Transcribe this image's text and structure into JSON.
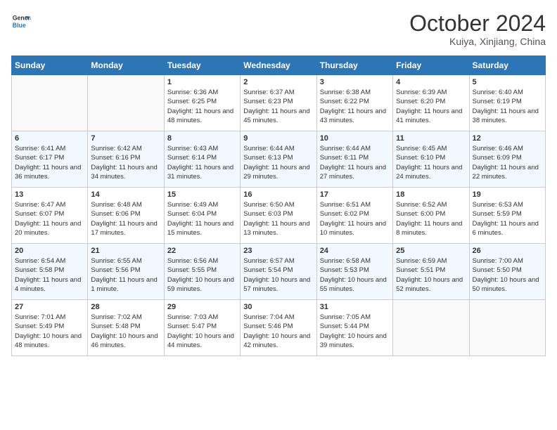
{
  "header": {
    "logo_line1": "General",
    "logo_line2": "Blue",
    "main_title": "October 2024",
    "subtitle": "Kuiya, Xinjiang, China"
  },
  "weekdays": [
    "Sunday",
    "Monday",
    "Tuesday",
    "Wednesday",
    "Thursday",
    "Friday",
    "Saturday"
  ],
  "weeks": [
    [
      {
        "day": "",
        "sunrise": "",
        "sunset": "",
        "daylight": ""
      },
      {
        "day": "",
        "sunrise": "",
        "sunset": "",
        "daylight": ""
      },
      {
        "day": "1",
        "sunrise": "Sunrise: 6:36 AM",
        "sunset": "Sunset: 6:25 PM",
        "daylight": "Daylight: 11 hours and 48 minutes."
      },
      {
        "day": "2",
        "sunrise": "Sunrise: 6:37 AM",
        "sunset": "Sunset: 6:23 PM",
        "daylight": "Daylight: 11 hours and 45 minutes."
      },
      {
        "day": "3",
        "sunrise": "Sunrise: 6:38 AM",
        "sunset": "Sunset: 6:22 PM",
        "daylight": "Daylight: 11 hours and 43 minutes."
      },
      {
        "day": "4",
        "sunrise": "Sunrise: 6:39 AM",
        "sunset": "Sunset: 6:20 PM",
        "daylight": "Daylight: 11 hours and 41 minutes."
      },
      {
        "day": "5",
        "sunrise": "Sunrise: 6:40 AM",
        "sunset": "Sunset: 6:19 PM",
        "daylight": "Daylight: 11 hours and 38 minutes."
      }
    ],
    [
      {
        "day": "6",
        "sunrise": "Sunrise: 6:41 AM",
        "sunset": "Sunset: 6:17 PM",
        "daylight": "Daylight: 11 hours and 36 minutes."
      },
      {
        "day": "7",
        "sunrise": "Sunrise: 6:42 AM",
        "sunset": "Sunset: 6:16 PM",
        "daylight": "Daylight: 11 hours and 34 minutes."
      },
      {
        "day": "8",
        "sunrise": "Sunrise: 6:43 AM",
        "sunset": "Sunset: 6:14 PM",
        "daylight": "Daylight: 11 hours and 31 minutes."
      },
      {
        "day": "9",
        "sunrise": "Sunrise: 6:44 AM",
        "sunset": "Sunset: 6:13 PM",
        "daylight": "Daylight: 11 hours and 29 minutes."
      },
      {
        "day": "10",
        "sunrise": "Sunrise: 6:44 AM",
        "sunset": "Sunset: 6:11 PM",
        "daylight": "Daylight: 11 hours and 27 minutes."
      },
      {
        "day": "11",
        "sunrise": "Sunrise: 6:45 AM",
        "sunset": "Sunset: 6:10 PM",
        "daylight": "Daylight: 11 hours and 24 minutes."
      },
      {
        "day": "12",
        "sunrise": "Sunrise: 6:46 AM",
        "sunset": "Sunset: 6:09 PM",
        "daylight": "Daylight: 11 hours and 22 minutes."
      }
    ],
    [
      {
        "day": "13",
        "sunrise": "Sunrise: 6:47 AM",
        "sunset": "Sunset: 6:07 PM",
        "daylight": "Daylight: 11 hours and 20 minutes."
      },
      {
        "day": "14",
        "sunrise": "Sunrise: 6:48 AM",
        "sunset": "Sunset: 6:06 PM",
        "daylight": "Daylight: 11 hours and 17 minutes."
      },
      {
        "day": "15",
        "sunrise": "Sunrise: 6:49 AM",
        "sunset": "Sunset: 6:04 PM",
        "daylight": "Daylight: 11 hours and 15 minutes."
      },
      {
        "day": "16",
        "sunrise": "Sunrise: 6:50 AM",
        "sunset": "Sunset: 6:03 PM",
        "daylight": "Daylight: 11 hours and 13 minutes."
      },
      {
        "day": "17",
        "sunrise": "Sunrise: 6:51 AM",
        "sunset": "Sunset: 6:02 PM",
        "daylight": "Daylight: 11 hours and 10 minutes."
      },
      {
        "day": "18",
        "sunrise": "Sunrise: 6:52 AM",
        "sunset": "Sunset: 6:00 PM",
        "daylight": "Daylight: 11 hours and 8 minutes."
      },
      {
        "day": "19",
        "sunrise": "Sunrise: 6:53 AM",
        "sunset": "Sunset: 5:59 PM",
        "daylight": "Daylight: 11 hours and 6 minutes."
      }
    ],
    [
      {
        "day": "20",
        "sunrise": "Sunrise: 6:54 AM",
        "sunset": "Sunset: 5:58 PM",
        "daylight": "Daylight: 11 hours and 4 minutes."
      },
      {
        "day": "21",
        "sunrise": "Sunrise: 6:55 AM",
        "sunset": "Sunset: 5:56 PM",
        "daylight": "Daylight: 11 hours and 1 minute."
      },
      {
        "day": "22",
        "sunrise": "Sunrise: 6:56 AM",
        "sunset": "Sunset: 5:55 PM",
        "daylight": "Daylight: 10 hours and 59 minutes."
      },
      {
        "day": "23",
        "sunrise": "Sunrise: 6:57 AM",
        "sunset": "Sunset: 5:54 PM",
        "daylight": "Daylight: 10 hours and 57 minutes."
      },
      {
        "day": "24",
        "sunrise": "Sunrise: 6:58 AM",
        "sunset": "Sunset: 5:53 PM",
        "daylight": "Daylight: 10 hours and 55 minutes."
      },
      {
        "day": "25",
        "sunrise": "Sunrise: 6:59 AM",
        "sunset": "Sunset: 5:51 PM",
        "daylight": "Daylight: 10 hours and 52 minutes."
      },
      {
        "day": "26",
        "sunrise": "Sunrise: 7:00 AM",
        "sunset": "Sunset: 5:50 PM",
        "daylight": "Daylight: 10 hours and 50 minutes."
      }
    ],
    [
      {
        "day": "27",
        "sunrise": "Sunrise: 7:01 AM",
        "sunset": "Sunset: 5:49 PM",
        "daylight": "Daylight: 10 hours and 48 minutes."
      },
      {
        "day": "28",
        "sunrise": "Sunrise: 7:02 AM",
        "sunset": "Sunset: 5:48 PM",
        "daylight": "Daylight: 10 hours and 46 minutes."
      },
      {
        "day": "29",
        "sunrise": "Sunrise: 7:03 AM",
        "sunset": "Sunset: 5:47 PM",
        "daylight": "Daylight: 10 hours and 44 minutes."
      },
      {
        "day": "30",
        "sunrise": "Sunrise: 7:04 AM",
        "sunset": "Sunset: 5:46 PM",
        "daylight": "Daylight: 10 hours and 42 minutes."
      },
      {
        "day": "31",
        "sunrise": "Sunrise: 7:05 AM",
        "sunset": "Sunset: 5:44 PM",
        "daylight": "Daylight: 10 hours and 39 minutes."
      },
      {
        "day": "",
        "sunrise": "",
        "sunset": "",
        "daylight": ""
      },
      {
        "day": "",
        "sunrise": "",
        "sunset": "",
        "daylight": ""
      }
    ]
  ]
}
